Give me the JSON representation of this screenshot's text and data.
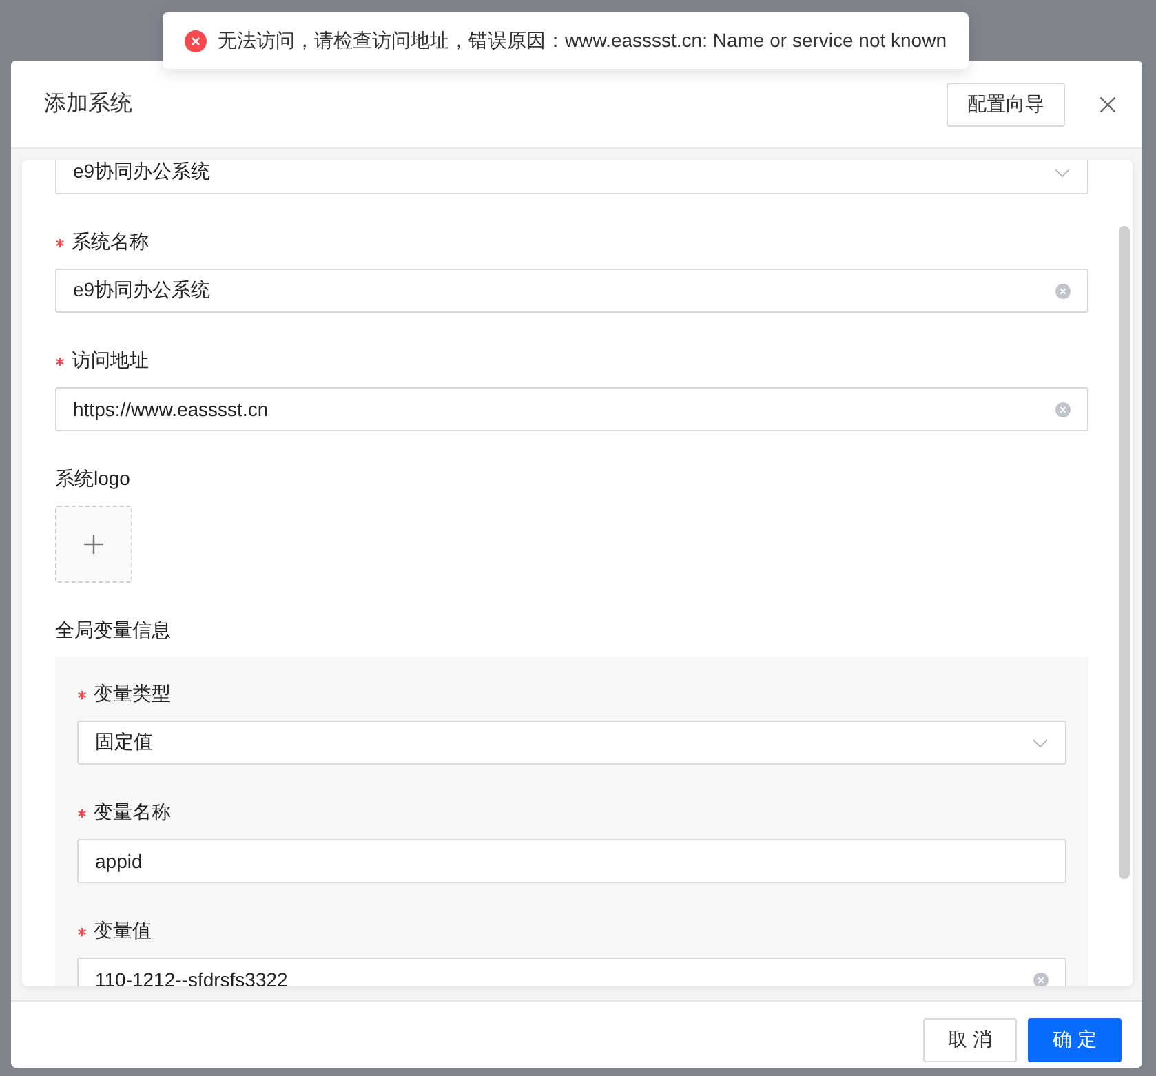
{
  "toast": {
    "kind": "error",
    "message": "无法访问，请检查访问地址，错误原因：www.easssst.cn: Name or service not known"
  },
  "dialog": {
    "title": "添加系统",
    "guide_button": "配置向导",
    "fields": [
      {
        "kind": "select",
        "value": "e9协同办公系统"
      },
      {
        "kind": "input",
        "label": "系统名称",
        "required": true,
        "value": "e9协同办公系统",
        "clearable": true
      },
      {
        "kind": "input",
        "label": "访问地址",
        "required": true,
        "value": "https://www.easssst.cn",
        "clearable": true
      },
      {
        "kind": "upload",
        "label": "系统logo",
        "required": false
      }
    ],
    "variables": {
      "label": "全局变量信息",
      "fields": [
        {
          "kind": "select",
          "label": "变量类型",
          "required": true,
          "value": "固定值"
        },
        {
          "kind": "input",
          "label": "变量名称",
          "required": true,
          "value": "appid",
          "clearable": false
        },
        {
          "kind": "input",
          "label": "变量值",
          "required": true,
          "value": "110-1212--sfdrsfs3322",
          "clearable": true
        }
      ]
    },
    "footer": {
      "cancel": "取 消",
      "ok": "确 定"
    }
  }
}
